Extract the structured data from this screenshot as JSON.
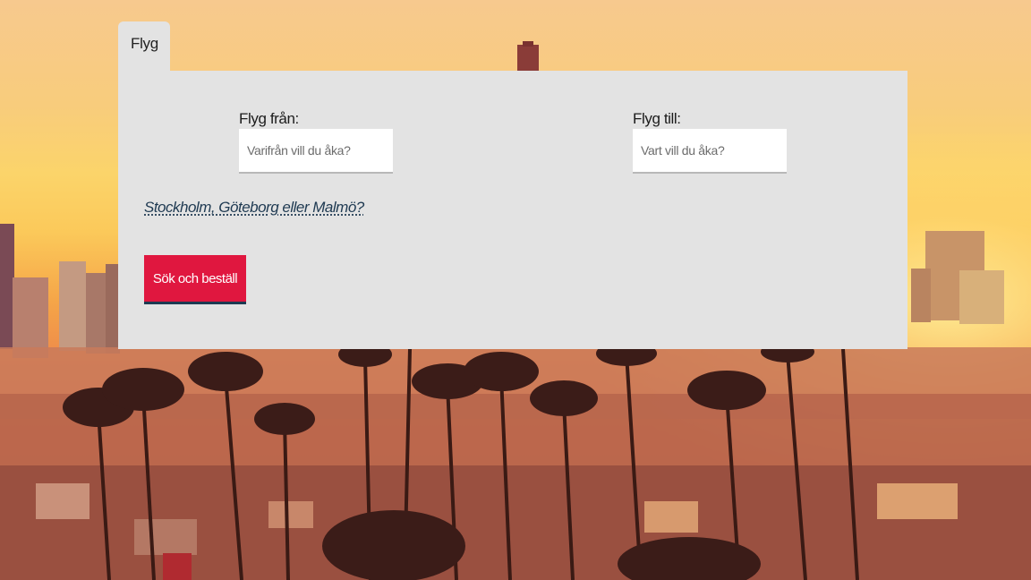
{
  "tabs": [
    {
      "label": "Flyg",
      "active": true
    }
  ],
  "form": {
    "from": {
      "label": "Flyg från:",
      "placeholder": "Varifrån vill du åka?",
      "value": ""
    },
    "to": {
      "label": "Flyg till:",
      "placeholder": "Vart vill du åka?",
      "value": ""
    },
    "city_link": "Stockholm, Göteborg eller Malmö?",
    "submit_label": "Sök och beställ"
  },
  "colors": {
    "panel": "#e3e3e3",
    "button": "#e0173f",
    "button_underline": "#1d3b52",
    "link": "#1f3a52"
  },
  "background": {
    "icon": "sunset-city-palm-trees-photo"
  }
}
